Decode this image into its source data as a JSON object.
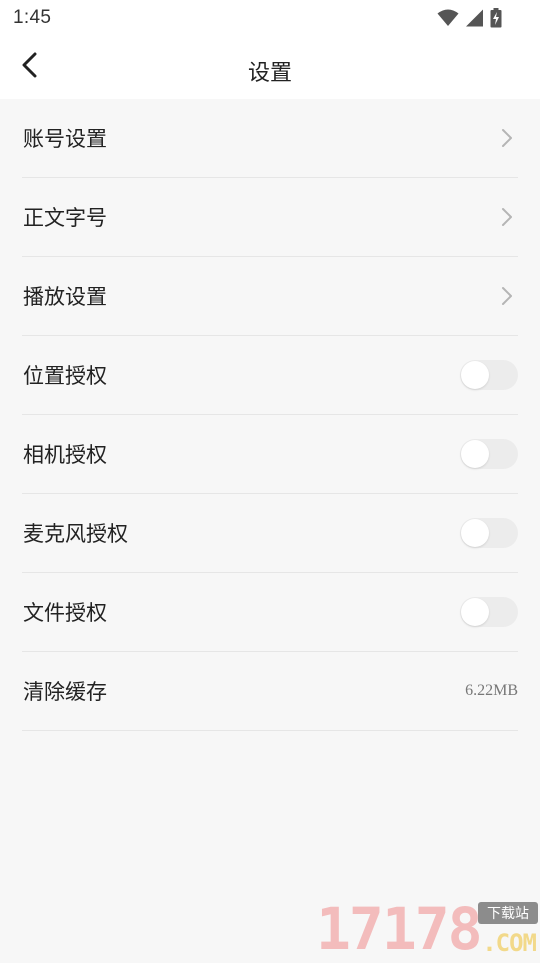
{
  "status_bar": {
    "time": "1:45",
    "icons": [
      "wifi-icon",
      "cellular-signal-icon",
      "battery-charging-icon"
    ]
  },
  "header": {
    "title": "设置",
    "back_icon": "chevron-left-icon"
  },
  "settings": {
    "items": [
      {
        "label": "账号设置",
        "control": "chevron"
      },
      {
        "label": "正文字号",
        "control": "chevron"
      },
      {
        "label": "播放设置",
        "control": "chevron"
      },
      {
        "label": "位置授权",
        "control": "toggle",
        "on": false
      },
      {
        "label": "相机授权",
        "control": "toggle",
        "on": false
      },
      {
        "label": "麦克风授权",
        "control": "toggle",
        "on": false
      },
      {
        "label": "文件授权",
        "control": "toggle",
        "on": false
      },
      {
        "label": "清除缓存",
        "control": "value",
        "value": "6.22MB"
      }
    ]
  },
  "watermark": {
    "digits": "17178",
    "badge": "下载站",
    "domain": ".COM"
  },
  "colors": {
    "background": "#f7f7f7",
    "header_background": "#ffffff",
    "divider": "#e6e6e6",
    "toggle_off": "#ececec",
    "chevron": "#b5b5b5"
  }
}
